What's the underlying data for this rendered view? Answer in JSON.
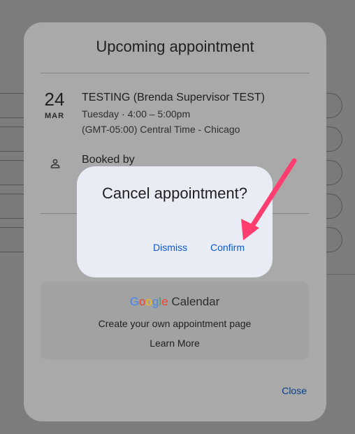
{
  "panel": {
    "title": "Upcoming appointment",
    "date": {
      "day": "24",
      "month": "MAR"
    },
    "event": {
      "title": "TESTING (Brenda Supervisor TEST)",
      "when": "Tuesday · 4:00 – 5:00pm",
      "timezone": "(GMT-05:00) Central Time - Chicago"
    },
    "booked_by_label": "Booked by",
    "booked_by_icon": "person-icon"
  },
  "google_calendar": {
    "logo_letters": [
      "G",
      "o",
      "o",
      "g",
      "l",
      "e"
    ],
    "logo_colors": [
      "#4285F4",
      "#EA4335",
      "#FBBC05",
      "#4285F4",
      "#34A853",
      "#EA4335"
    ],
    "product": "Calendar",
    "text": "Create your own appointment page",
    "link": "Learn More"
  },
  "close_label": "Close",
  "dialog": {
    "title": "Cancel appointment?",
    "dismiss": "Dismiss",
    "confirm": "Confirm"
  },
  "annotation": {
    "arrow_color": "#ff3d6e"
  }
}
